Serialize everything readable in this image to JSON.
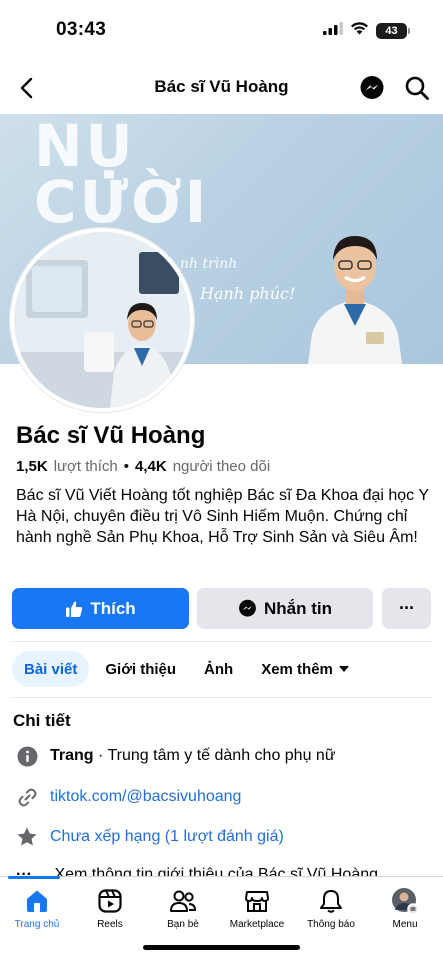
{
  "status_bar": {
    "time": "03:43",
    "battery": "43"
  },
  "nav": {
    "title": "Bác sĩ Vũ Hoàng"
  },
  "cover": {
    "headline_line1": "NỤ",
    "headline_line2": "CƯỜI",
    "script_line1": "nh trình",
    "script_line2": "Hạnh phúc!"
  },
  "profile": {
    "name": "Bác sĩ Vũ Hoàng",
    "likes_count": "1,5K",
    "likes_label": "lượt thích",
    "separator": "•",
    "followers_count": "4,4K",
    "followers_label": "người theo dõi",
    "bio": "Bác sĩ Vũ Viết Hoàng tốt nghiệp Bác sĩ Đa Khoa đại học Y Hà Nội, chuyên điều trị Vô Sinh Hiếm Muộn. Chứng chỉ hành nghề Sản Phụ Khoa, Hỗ Trợ Sinh Sản và Siêu Âm!"
  },
  "actions": {
    "like_label": "Thích",
    "message_label": "Nhắn tin",
    "more_label": "···"
  },
  "tabs": [
    {
      "label": "Bài viết",
      "active": true
    },
    {
      "label": "Giới thiệu",
      "active": false
    },
    {
      "label": "Ảnh",
      "active": false
    },
    {
      "label": "Xem thêm",
      "active": false
    }
  ],
  "details": {
    "title": "Chi tiết",
    "category_label": "Trang",
    "category_value": "· Trung tâm y tế dành cho phụ nữ",
    "link": "tiktok.com/@bacsivuhoang",
    "rating": "Chưa xếp hạng (1 lượt đánh giá)",
    "cut_row": "Xem thông tin giới thiệu của Bác sĩ Vũ Hoàng"
  },
  "bottom_nav": [
    {
      "label": "Trang chủ",
      "icon": "home-icon",
      "active": true
    },
    {
      "label": "Reels",
      "icon": "reels-icon",
      "active": false
    },
    {
      "label": "Bạn bè",
      "icon": "friends-icon",
      "active": false
    },
    {
      "label": "Marketplace",
      "icon": "marketplace-icon",
      "active": false
    },
    {
      "label": "Thông báo",
      "icon": "bell-icon",
      "active": false
    },
    {
      "label": "Menu",
      "icon": "menu-avatar-icon",
      "active": false
    }
  ],
  "colors": {
    "accent": "#1877f2",
    "secondary_button": "#e4e6eb",
    "tab_active_bg": "#e7f3ff",
    "link": "#216fdb",
    "muted_text": "#65676b"
  }
}
